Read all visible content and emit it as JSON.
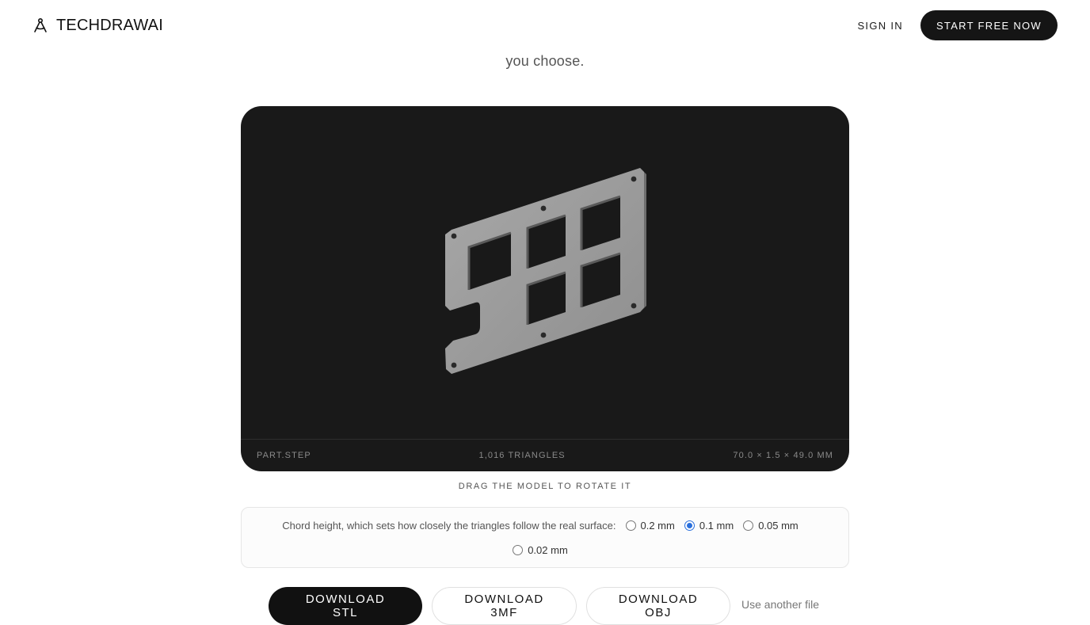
{
  "header": {
    "brand": "TECHDRAWAI",
    "sign_in": "SIGN IN",
    "start_free": "START FREE NOW"
  },
  "intro": "you choose.",
  "viewer": {
    "file_name": "PART.STEP",
    "triangles": "1,016 TRIANGLES",
    "dimensions": "70.0 × 1.5 × 49.0 MM",
    "background_color": "#191919",
    "model_color": "#9a9a9a"
  },
  "hint": "DRAG THE MODEL TO ROTATE IT",
  "options": {
    "label": "Chord height, which sets how closely the triangles follow the real surface:",
    "choices": [
      "0.2 mm",
      "0.1 mm",
      "0.05 mm",
      "0.02 mm"
    ],
    "selected": "0.1 mm",
    "accent_color": "#2a6fdc"
  },
  "downloads": {
    "stl": "DOWNLOAD STL",
    "three_mf": "DOWNLOAD 3MF",
    "obj": "DOWNLOAD OBJ",
    "another_file": "Use another file"
  }
}
